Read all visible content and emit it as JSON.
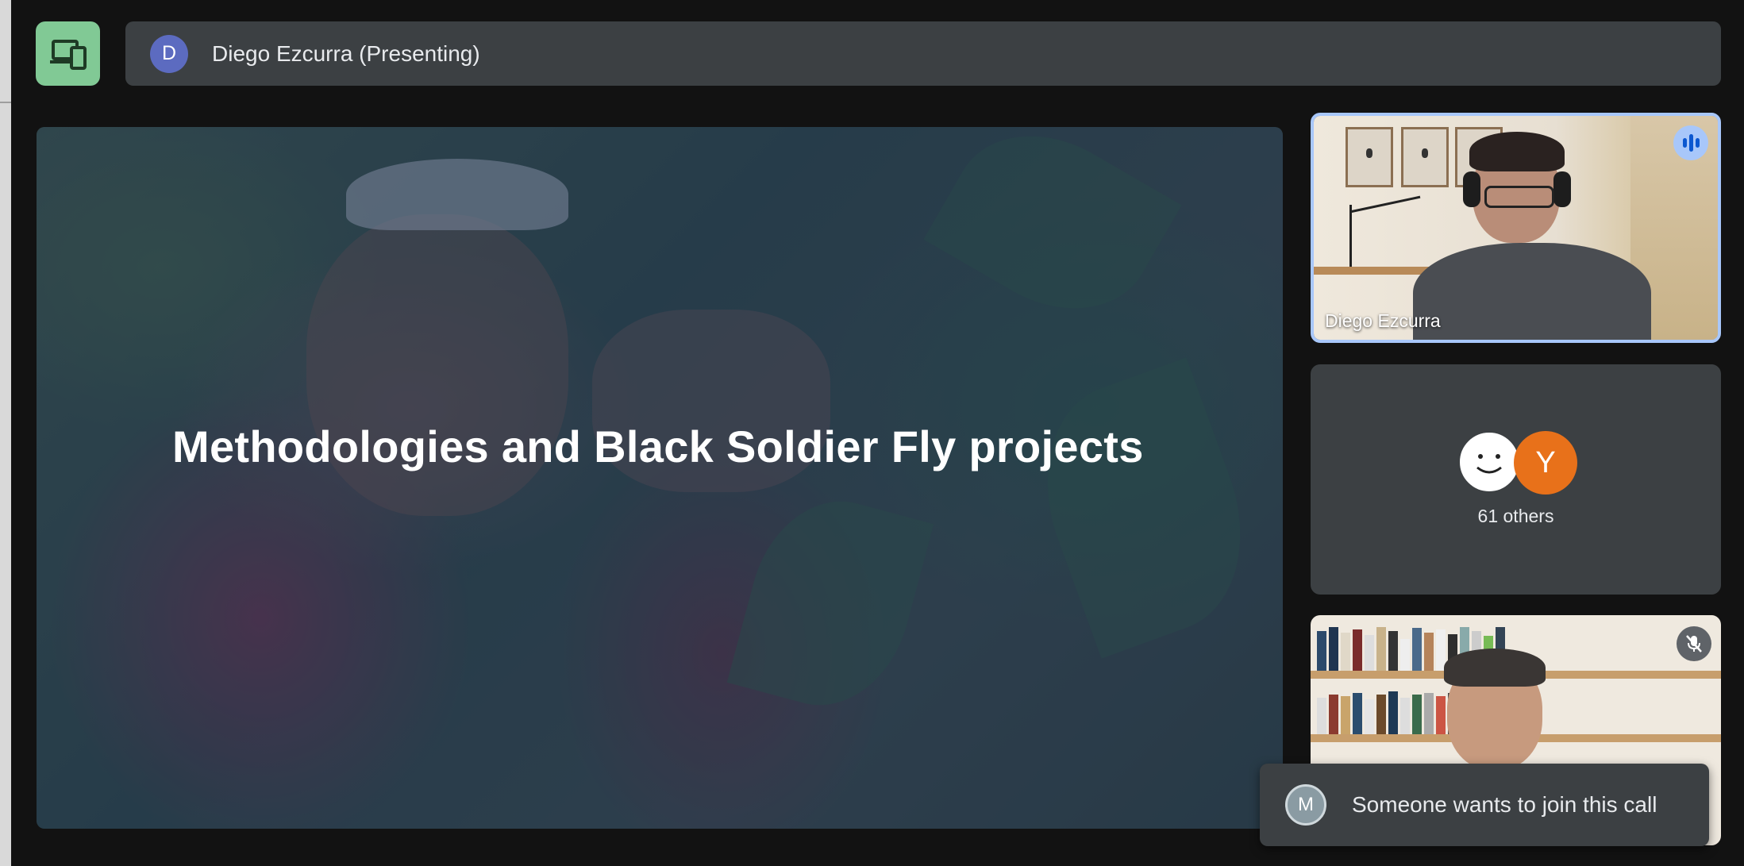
{
  "presenter_bar": {
    "avatar_initial": "D",
    "label": "Diego Ezcurra (Presenting)",
    "present_icon": "devices-icon"
  },
  "slide": {
    "title": "Methodologies and Black Soldier Fly projects"
  },
  "participants": {
    "speaker_name": "Diego Ezcurra",
    "speaking_indicator": "audio-level-icon",
    "others_initial": "Y",
    "others_label": "61 others",
    "bottom_tile_status": "mic-off-icon"
  },
  "notification": {
    "avatar_initial": "M",
    "text": "Someone wants to join this call"
  },
  "colors": {
    "present_button": "#81c995",
    "speaking_border": "#a8c7fa",
    "avatar_purple": "#5c6bc0",
    "avatar_orange": "#e8711a",
    "panel": "#3c4043"
  }
}
